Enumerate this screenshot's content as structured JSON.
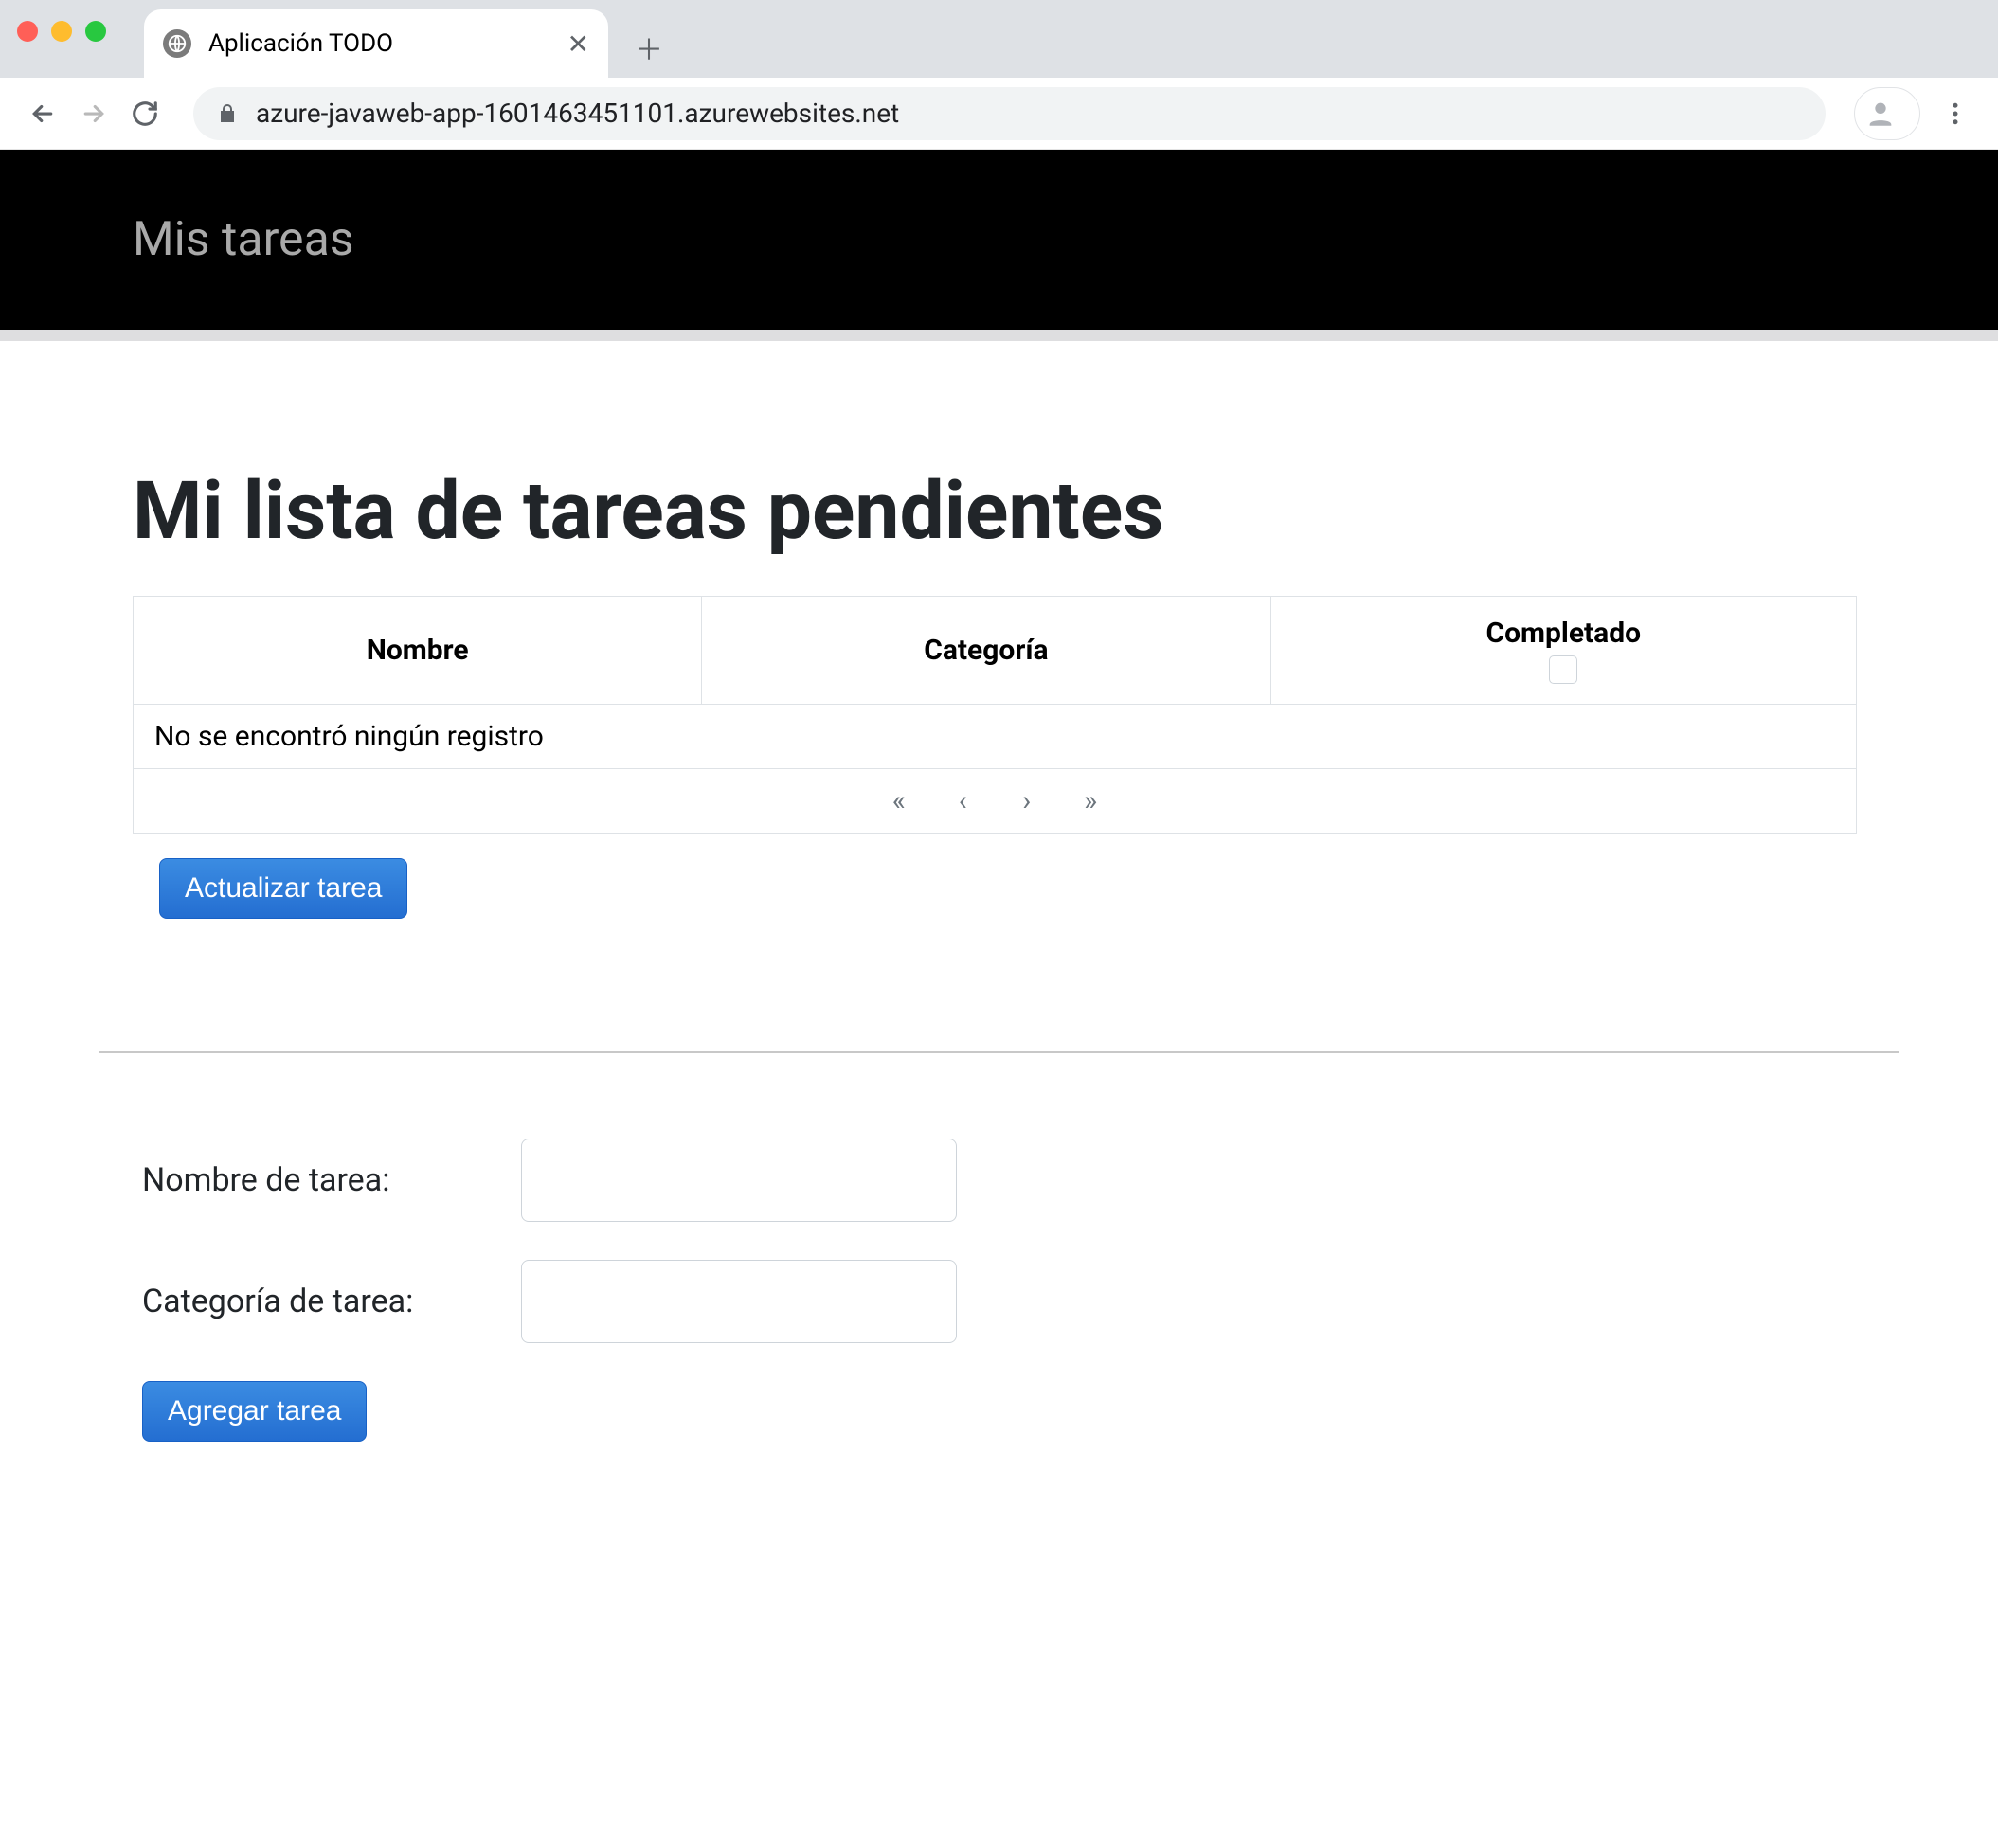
{
  "browser": {
    "tab_title": "Aplicación TODO",
    "url": "azure-javaweb-app-1601463451101.azurewebsites.net"
  },
  "navbar": {
    "brand": "Mis tareas"
  },
  "page": {
    "heading": "Mi lista de tareas pendientes"
  },
  "table": {
    "headers": {
      "name": "Nombre",
      "category": "Categoría",
      "completed": "Completado"
    },
    "empty_message": "No se encontró ningún registro",
    "paginator": {
      "first": "«",
      "prev": "‹",
      "next": "›",
      "last": "»"
    }
  },
  "buttons": {
    "update": "Actualizar tarea",
    "add": "Agregar tarea"
  },
  "form": {
    "name_label": "Nombre de tarea:",
    "category_label": "Categoría de tarea:",
    "name_value": "",
    "category_value": ""
  }
}
